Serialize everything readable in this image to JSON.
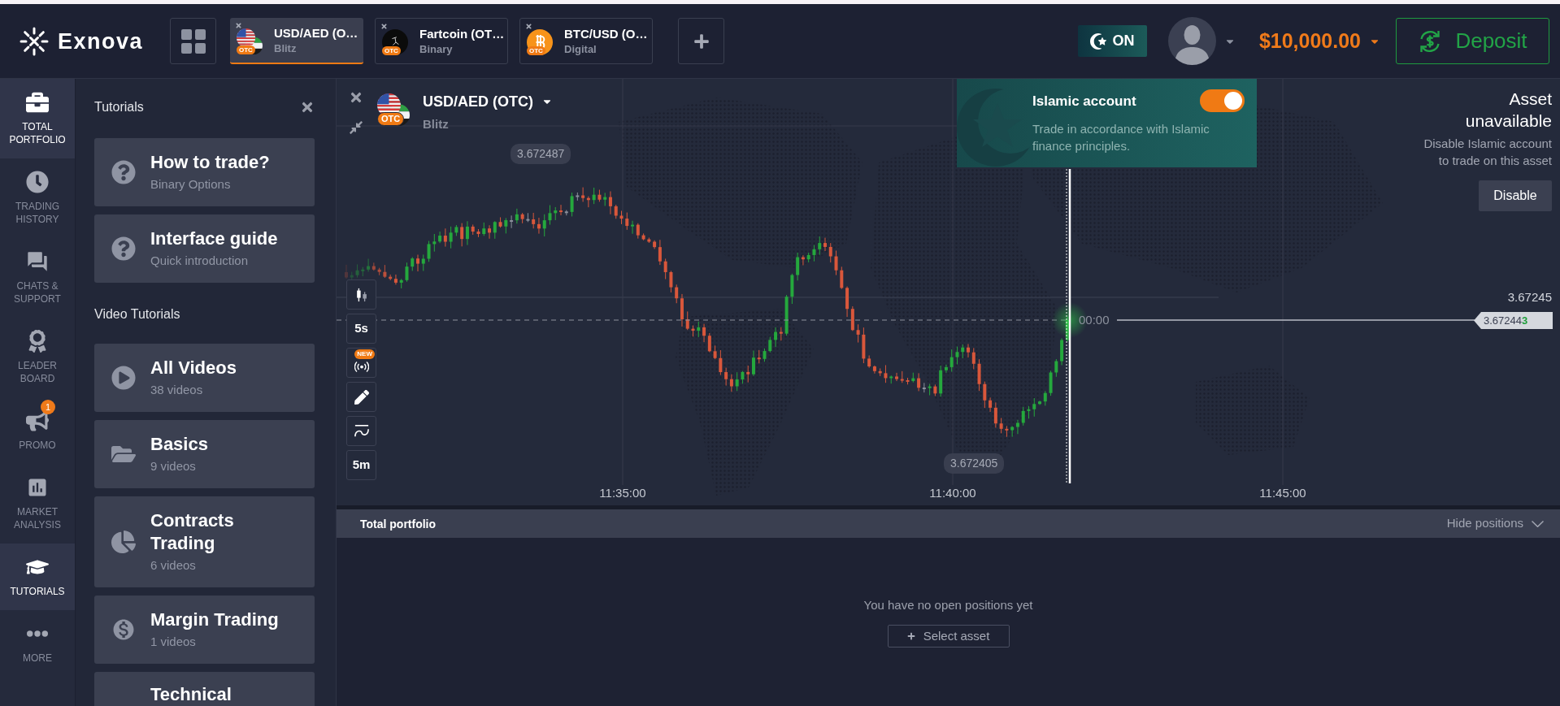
{
  "header": {
    "logo": "Exnova",
    "asset_tabs": [
      {
        "title": "USD/AED (O…",
        "subtitle": "Blitz",
        "badge": "OTC",
        "selected": true
      },
      {
        "title": "Fartcoin (OT…",
        "subtitle": "Binary",
        "badge": "OTC",
        "selected": false
      },
      {
        "title": "BTC/USD (O…",
        "subtitle": "Digital",
        "badge": "OTC",
        "selected": false
      }
    ],
    "islamic_mode": "ON",
    "balance": "$10,000.00",
    "deposit": "Deposit"
  },
  "sidebar": {
    "items": [
      {
        "label": "TOTAL PORTFOLIO",
        "selected": true
      },
      {
        "label": "TRADING HISTORY",
        "selected": false
      },
      {
        "label": "CHATS & SUPPORT",
        "selected": false
      },
      {
        "label": "LEADER BOARD",
        "selected": false
      },
      {
        "label": "PROMO",
        "selected": false,
        "badge": "1"
      },
      {
        "label": "MARKET ANALYSIS",
        "selected": false
      },
      {
        "label": "TUTORIALS",
        "selected": true
      },
      {
        "label": "MORE",
        "selected": false
      }
    ]
  },
  "tutorials": {
    "title": "Tutorials",
    "guides": [
      {
        "title": "How to trade?",
        "subtitle": "Binary Options"
      },
      {
        "title": "Interface guide",
        "subtitle": "Quick introduction"
      }
    ],
    "video_heading": "Video Tutorials",
    "videos": [
      {
        "title": "All Videos",
        "subtitle": "38 videos"
      },
      {
        "title": "Basics",
        "subtitle": "9 videos"
      },
      {
        "title": "Contracts Trading",
        "subtitle": "6 videos"
      },
      {
        "title": "Margin Trading",
        "subtitle": "1 videos"
      },
      {
        "title": "Technical"
      }
    ]
  },
  "chart": {
    "asset": {
      "title": "USD/AED (OTC)",
      "subtitle": "Blitz",
      "badge": "OTC"
    },
    "toolbar": [
      {
        "kind": "icon"
      },
      {
        "kind": "text",
        "label": "5s"
      },
      {
        "kind": "icon",
        "badge": "NEW"
      },
      {
        "kind": "icon"
      },
      {
        "kind": "icon"
      },
      {
        "kind": "text",
        "label": "5m"
      }
    ],
    "price_bubbles": [
      "3.672487",
      "3.672405"
    ],
    "price_scale": [
      "3.67245"
    ],
    "current_price": "3.672443",
    "timer": "00:00",
    "time_axis": [
      "11:35:00",
      "11:40:00",
      "11:45:00"
    ]
  },
  "islamic_account": {
    "title": "Islamic account",
    "description": "Trade in accordance with Islamic finance principles.",
    "on": true
  },
  "asset_notice": {
    "title": "Asset unavailable",
    "message": "Disable Islamic account to trade on this asset",
    "button": "Disable"
  },
  "portfolio": {
    "title": "Total portfolio",
    "toggle": "Hide positions",
    "empty_message": "You have no open positions yet",
    "button": "Select asset"
  }
}
